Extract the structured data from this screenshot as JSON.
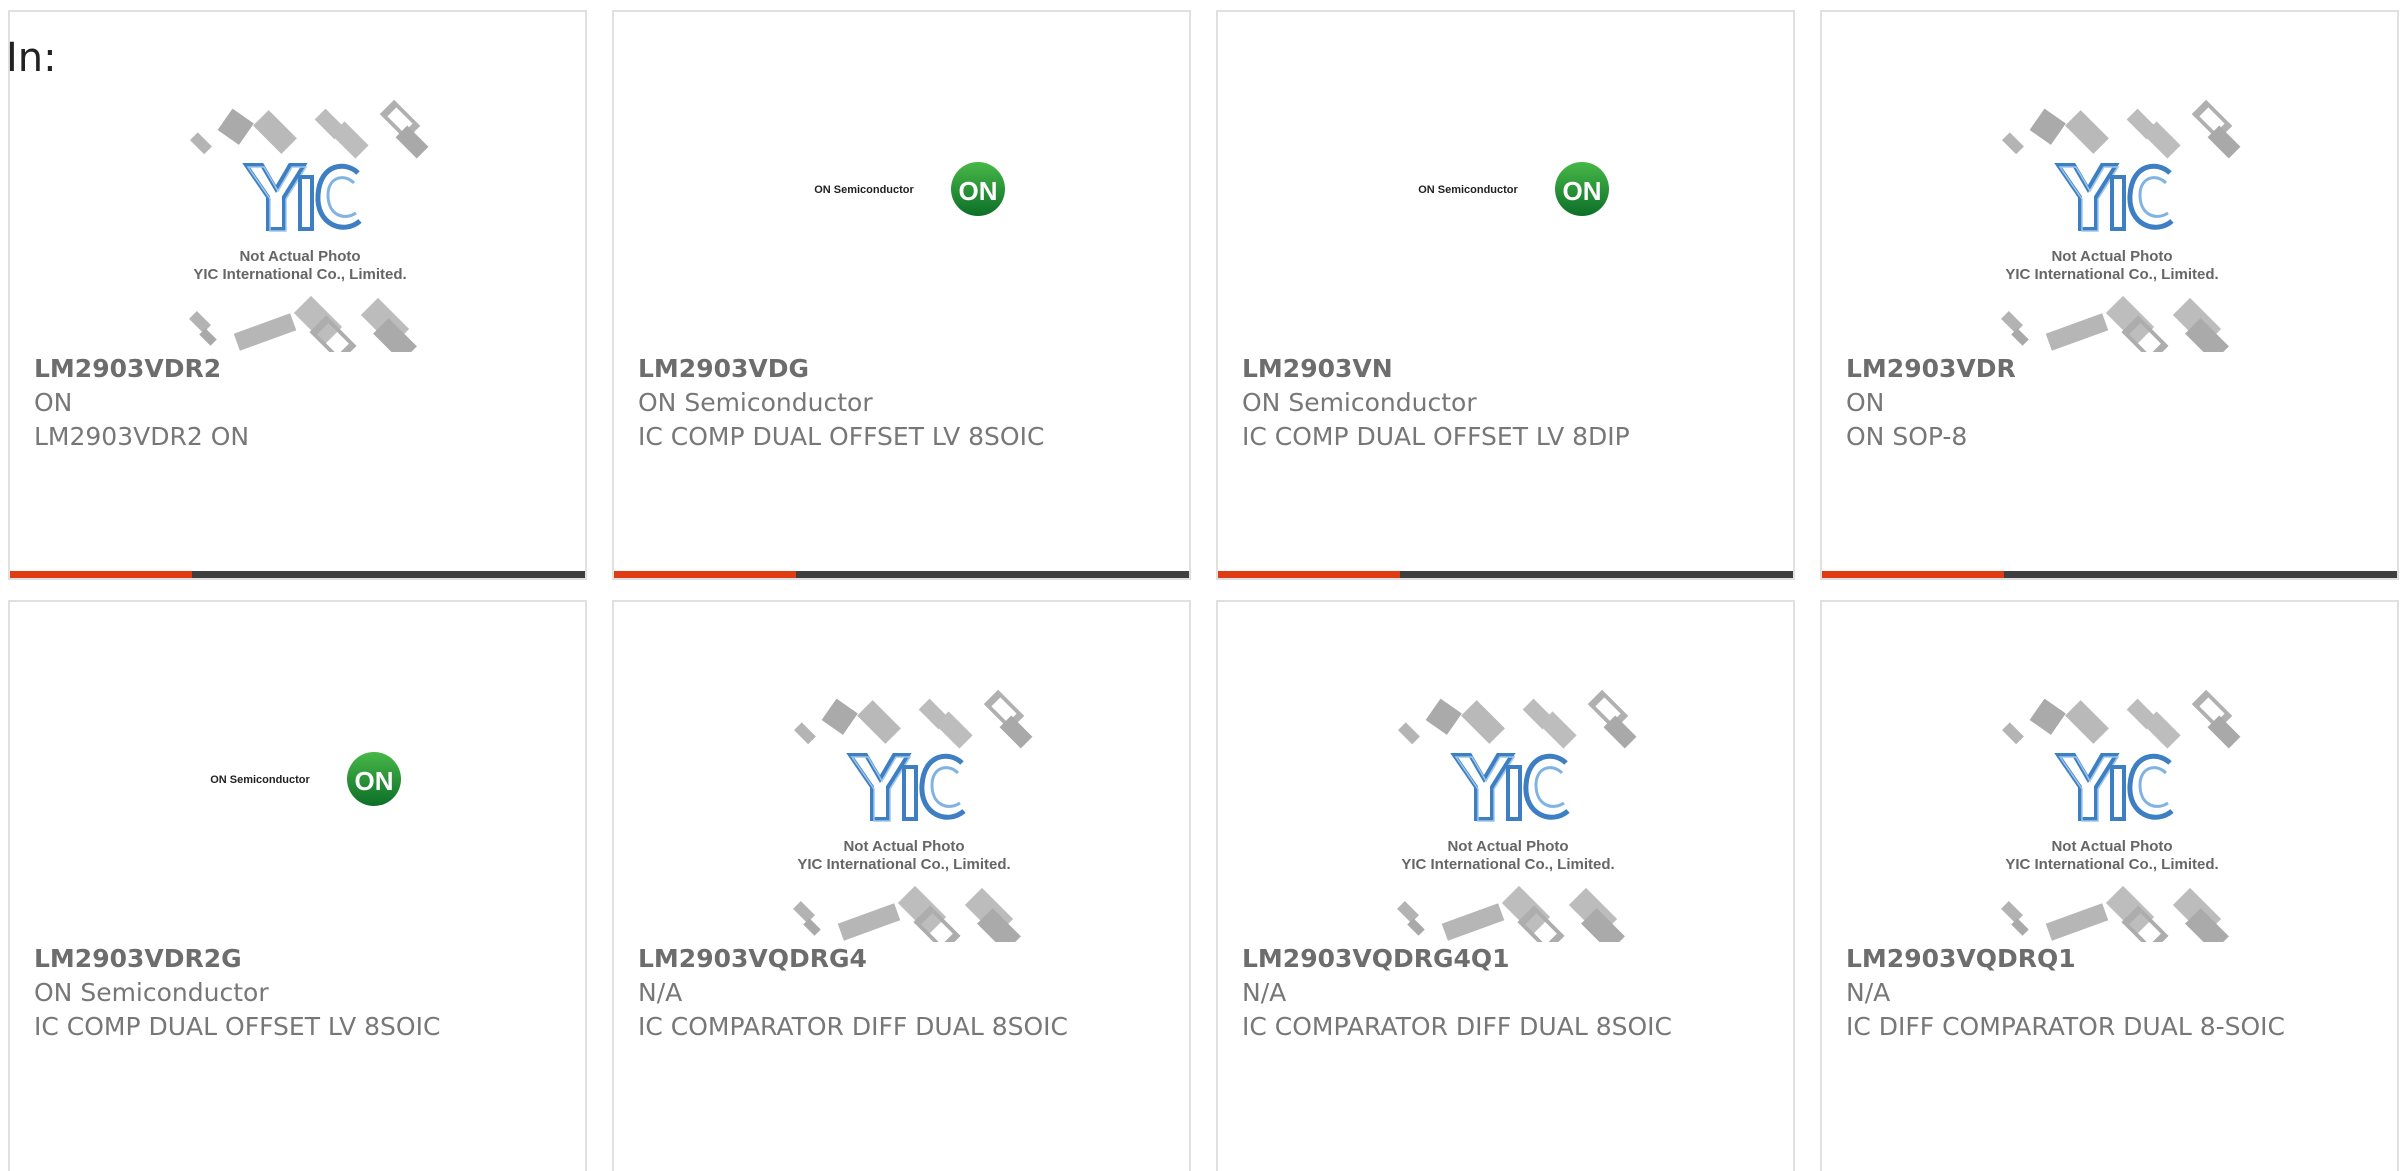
{
  "prefix": "In:",
  "accent_color": "#e03c14",
  "bar_color": "#3f3f3f",
  "yic_photo": {
    "caption_line1": "Not Actual Photo",
    "caption_line2": "YIC International Co., Limited."
  },
  "on_logo": {
    "text": "ON Semiconductor",
    "badge": "ON"
  },
  "products": [
    {
      "part": "LM2903VDR2",
      "manufacturer": "ON",
      "description": "LM2903VDR2 ON",
      "image": "yic-photo-placeholder"
    },
    {
      "part": "LM2903VDG",
      "manufacturer": "ON Semiconductor",
      "description": "IC COMP DUAL OFFSET LV 8SOIC",
      "image": "on-semiconductor-logo"
    },
    {
      "part": "LM2903VN",
      "manufacturer": "ON Semiconductor",
      "description": "IC COMP DUAL OFFSET LV 8DIP",
      "image": "on-semiconductor-logo"
    },
    {
      "part": "LM2903VDR",
      "manufacturer": "ON",
      "description": "ON SOP-8",
      "image": "yic-photo-placeholder"
    },
    {
      "part": "LM2903VDR2G",
      "manufacturer": "ON Semiconductor",
      "description": "IC COMP DUAL OFFSET LV 8SOIC",
      "image": "on-semiconductor-logo"
    },
    {
      "part": "LM2903VQDRG4",
      "manufacturer": "N/A",
      "description": "IC COMPARATOR DIFF DUAL 8SOIC",
      "image": "yic-photo-placeholder"
    },
    {
      "part": "LM2903VQDRG4Q1",
      "manufacturer": "N/A",
      "description": "IC COMPARATOR DIFF DUAL 8SOIC",
      "image": "yic-photo-placeholder"
    },
    {
      "part": "LM2903VQDRQ1",
      "manufacturer": "N/A",
      "description": "IC DIFF COMPARATOR DUAL 8-SOIC",
      "image": "yic-photo-placeholder"
    }
  ]
}
